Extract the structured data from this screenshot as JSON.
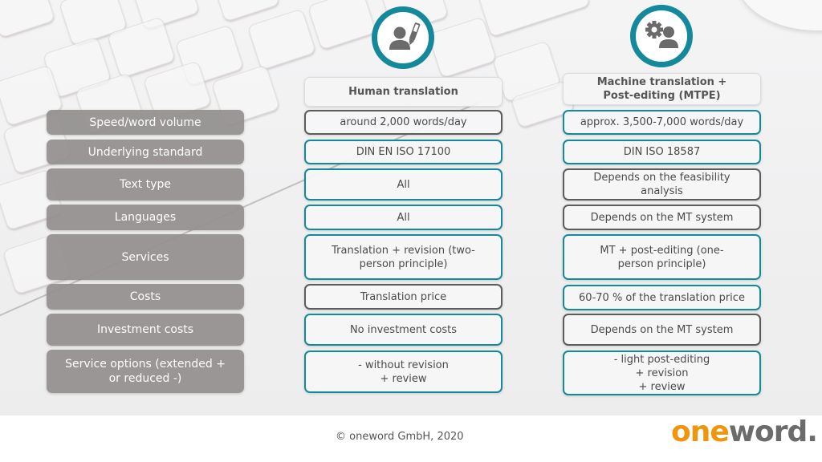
{
  "columns": {
    "human": {
      "title": "Human translation",
      "icon": "person-pen-icon"
    },
    "mtpe": {
      "title_line1": "Machine translation +",
      "title_line2": "Post-editing (MTPE)",
      "icon": "gear-person-icon"
    }
  },
  "rows": [
    {
      "label": "Speed/word volume",
      "human": "around 2,000 words/day",
      "mtpe": "approx. 3,500-7,000 words/day",
      "human_border": "gray",
      "mtpe_border": "teal"
    },
    {
      "label": "Underlying standard",
      "human": "DIN EN ISO 17100",
      "mtpe": "DIN ISO 18587",
      "human_border": "teal",
      "mtpe_border": "teal"
    },
    {
      "label": "Text type",
      "human": "All",
      "mtpe": "Depends on the feasibility analysis",
      "human_border": "teal",
      "mtpe_border": "gray"
    },
    {
      "label": "Languages",
      "human": "All",
      "mtpe": "Depends on the MT system",
      "human_border": "teal",
      "mtpe_border": "gray"
    },
    {
      "label": "Services",
      "human": "Translation + revision (two-person principle)",
      "mtpe": "MT + post-editing (one-person principle)",
      "human_border": "teal",
      "mtpe_border": "teal"
    },
    {
      "label": "Costs",
      "human": "Translation price",
      "mtpe": "60-70 % of the translation price",
      "human_border": "gray",
      "mtpe_border": "teal"
    },
    {
      "label": "Investment costs",
      "human": "No investment costs",
      "mtpe": "Depends on the MT system",
      "human_border": "teal",
      "mtpe_border": "gray"
    },
    {
      "label": "Service options (extended + or reduced -)",
      "human_lines": [
        "- without revision",
        "+ review"
      ],
      "mtpe_lines": [
        "- light post-editing",
        "+ revision",
        "+ review"
      ],
      "human_border": "teal",
      "mtpe_border": "teal"
    }
  ],
  "colors": {
    "teal": "#14899c",
    "dark_gray_border": "#5c5c5c",
    "label_bg": "#928f8e",
    "logo_orange": "#f0960e",
    "logo_gray": "#6b6b6b"
  },
  "footer": {
    "copyright": "© oneword GmbH, 2020",
    "logo_part1": "one",
    "logo_part2": "word."
  }
}
